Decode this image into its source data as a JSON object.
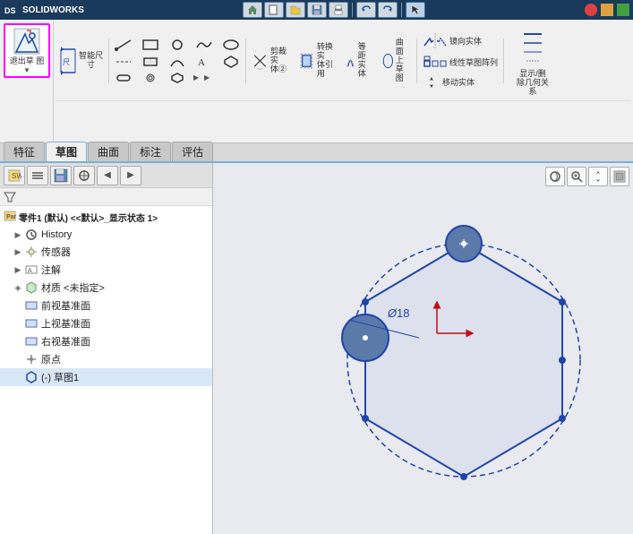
{
  "app": {
    "name": "SOLIDWORKS",
    "title": "SolidWorks"
  },
  "ribbon": {
    "toolbar1_buttons": [
      {
        "id": "home",
        "label": "🏠"
      },
      {
        "id": "folder",
        "label": "📁"
      },
      {
        "id": "save",
        "label": "💾"
      },
      {
        "id": "print",
        "label": "🖨"
      },
      {
        "id": "undo",
        "label": "↩"
      },
      {
        "id": "redo",
        "label": "↪"
      },
      {
        "id": "cursor",
        "label": "↖"
      },
      {
        "id": "settings",
        "label": "⚙"
      }
    ],
    "exit_sketch_label": "退出草\n图",
    "smart_dim_label": "智能尺\n寸",
    "sketch_tools": [
      "剪裁实体②",
      "转换实体引用",
      "等距实体",
      "曲面上草图",
      "镜向实体",
      "线性草图阵列",
      "移动实体",
      "显示/删除几何关系"
    ]
  },
  "tabs": [
    {
      "id": "feature",
      "label": "特征"
    },
    {
      "id": "sketch",
      "label": "草图"
    },
    {
      "id": "surface",
      "label": "曲面"
    },
    {
      "id": "annotation",
      "label": "标注"
    },
    {
      "id": "evaluate",
      "label": "评估"
    }
  ],
  "active_tab": "sketch",
  "feature_tree": {
    "header": "零件1 (默认) <<默认>_显示状态 1>",
    "items": [
      {
        "id": "history",
        "label": "History",
        "icon": "clock",
        "indent": 1
      },
      {
        "id": "sensor",
        "label": "传感器",
        "icon": "sensor",
        "indent": 1
      },
      {
        "id": "annotation",
        "label": "注解",
        "icon": "annotation",
        "indent": 1
      },
      {
        "id": "material",
        "label": "材质 <未指定>",
        "icon": "material",
        "indent": 1
      },
      {
        "id": "front_plane",
        "label": "前视基准面",
        "icon": "plane",
        "indent": 1
      },
      {
        "id": "top_plane",
        "label": "上视基准面",
        "icon": "plane",
        "indent": 1
      },
      {
        "id": "right_plane",
        "label": "右视基准面",
        "icon": "plane",
        "indent": 1
      },
      {
        "id": "origin",
        "label": "原点",
        "icon": "origin",
        "indent": 1
      },
      {
        "id": "sketch1",
        "label": "(-) 草图1",
        "icon": "sketch",
        "indent": 1
      }
    ]
  },
  "viewport": {
    "dimension_label": "Ø18"
  }
}
